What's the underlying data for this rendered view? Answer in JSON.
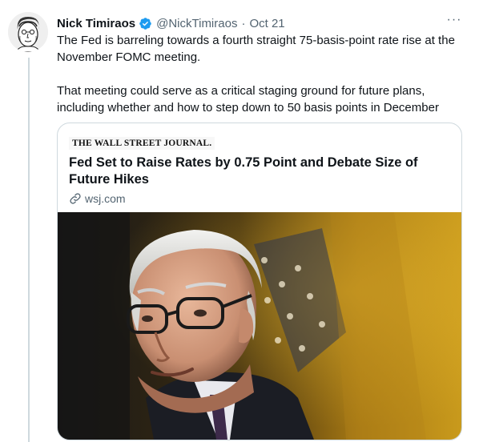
{
  "tweet": {
    "author_name": "Nick Timiraos",
    "handle": "@NickTimiraos",
    "separator": "·",
    "date": "Oct 21",
    "more_label": "···",
    "paragraphs": [
      "The Fed is barreling towards a fourth straight 75-basis-point rate rise at the November FOMC meeting.",
      "That meeting could serve as a critical staging ground for future plans, including whether and how to step down to 50 basis points in December"
    ],
    "verified_color": "#1d9bf0"
  },
  "card": {
    "publisher_logo": "THE WALL STREET JOURNAL.",
    "title": "Fed Set to Raise Rates by 0.75 Point and Debate Size of Future Hikes",
    "domain": "wsj.com",
    "link_icon": "link-icon",
    "image_subject": "photo-of-speaker-with-flag-backdrop"
  },
  "colors": {
    "text_primary": "#0f1419",
    "text_secondary": "#536471",
    "border": "#cfd9de"
  }
}
